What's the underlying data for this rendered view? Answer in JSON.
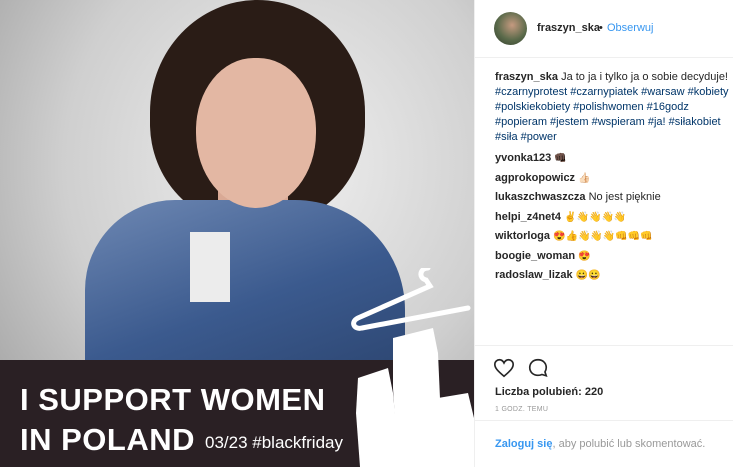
{
  "post": {
    "banner": {
      "line1": "I SUPPORT WOMEN",
      "line2": "IN POLAND",
      "subtext": "03/23 #blackfriday"
    }
  },
  "header": {
    "username": "fraszyn_ska",
    "separator": "•",
    "follow": "Obserwuj"
  },
  "caption": {
    "user": "fraszyn_ska",
    "text": "Ja to ja i tylko ja o sobie decyduje!",
    "hashtags": "#czarnyprotest #czarnypiatek #warsaw #kobiety #polskiekobiety #polishwomen #16godz #popieram #jestem #wspieram #ja! #siłakobiet #siła #power"
  },
  "comments": [
    {
      "user": "yvonka123",
      "text": "",
      "emoji": "👊🏿"
    },
    {
      "user": "agprokopowicz",
      "text": "",
      "emoji": "👍🏻"
    },
    {
      "user": "lukaszchwaszcza",
      "text": "No jest pięknie",
      "emoji": ""
    },
    {
      "user": "helpi_z4net4",
      "text": "",
      "emoji": "✌👋👋👋👋"
    },
    {
      "user": "wiktorloga",
      "text": "",
      "emoji": "😍👍👋👋👋👊👊👊"
    },
    {
      "user": "boogie_woman",
      "text": "",
      "emoji": "😍"
    },
    {
      "user": "radoslaw_lizak",
      "text": "",
      "emoji": "😀😀"
    }
  ],
  "actions": {
    "heart": "heart-icon",
    "comment": "comment-icon"
  },
  "likes": "Liczba polubień: 220",
  "timestamp": "1 GODZ. TEMU",
  "login": {
    "link": "Zaloguj się",
    "rest": ", aby polubić lub skomentować."
  },
  "colors": {
    "accent": "#3897f0",
    "hashtag": "#003569",
    "banner_bg": "#2a2024"
  }
}
